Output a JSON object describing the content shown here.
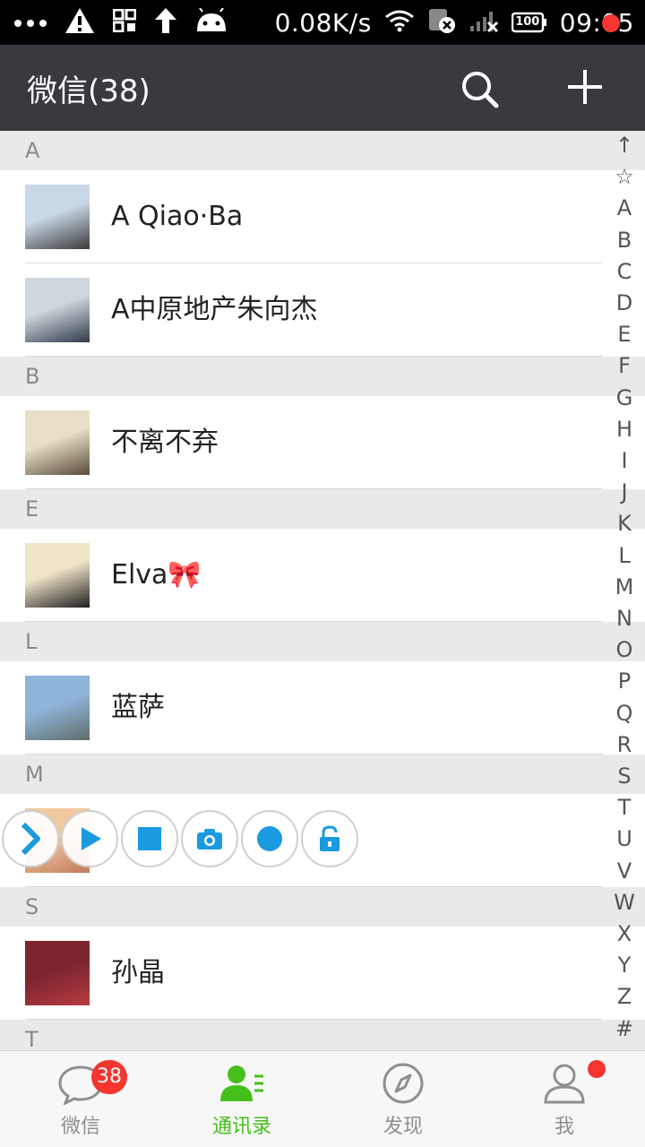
{
  "status_bar": {
    "network_speed": "0.08K/s",
    "battery": "100",
    "time": "09:05",
    "icons": [
      "more-dots-icon",
      "warning-icon",
      "qr-scan-icon",
      "upload-arrow-icon",
      "android-icon",
      "wifi-icon",
      "sim-no-service-icon",
      "signal-no-service-icon",
      "battery-icon"
    ]
  },
  "header": {
    "title": "微信(38)",
    "icons": [
      "search-icon",
      "add-icon"
    ]
  },
  "contacts": {
    "sections": [
      {
        "letter": "A",
        "items": [
          {
            "name": "A Qiao·Ba",
            "avatar_colors": [
              "#c9d8e6",
              "#3b3b3b"
            ]
          },
          {
            "name": "A中原地产朱向杰",
            "avatar_colors": [
              "#cfd6dc",
              "#2f3a4a"
            ]
          }
        ]
      },
      {
        "letter": "B",
        "items": [
          {
            "name": "不离不弃",
            "avatar_colors": [
              "#e8e0c6",
              "#5a4a3a"
            ]
          }
        ]
      },
      {
        "letter": "E",
        "items": [
          {
            "name": "Elva🎀",
            "avatar_colors": [
              "#efe3c8",
              "#1f1f1f"
            ]
          }
        ]
      },
      {
        "letter": "L",
        "items": [
          {
            "name": "蓝萨",
            "avatar_colors": [
              "#8fb4d9",
              "#5f6e6a"
            ]
          }
        ]
      },
      {
        "letter": "M",
        "items": [
          {
            "name": "",
            "avatar_colors": [
              "#f0c9a0",
              "#c07a5a"
            ]
          }
        ]
      },
      {
        "letter": "S",
        "items": [
          {
            "name": "孙晶",
            "avatar_colors": [
              "#7a2530",
              "#b83a40"
            ]
          }
        ]
      },
      {
        "letter": "T",
        "items": []
      }
    ]
  },
  "alphabet_index": [
    "↑",
    "☆",
    "A",
    "B",
    "C",
    "D",
    "E",
    "F",
    "G",
    "H",
    "I",
    "J",
    "K",
    "L",
    "M",
    "N",
    "O",
    "P",
    "Q",
    "R",
    "S",
    "T",
    "U",
    "V",
    "W",
    "X",
    "Y",
    "Z",
    "#"
  ],
  "floating_toolbar": {
    "buttons": [
      "collapse-arrow-icon",
      "play-icon",
      "stop-icon",
      "camera-icon",
      "record-icon",
      "unlock-icon"
    ]
  },
  "bottom_nav": {
    "tabs": [
      {
        "label": "微信",
        "icon": "chat-bubble-icon",
        "badge": "38"
      },
      {
        "label": "通讯录",
        "icon": "contacts-icon",
        "active": true
      },
      {
        "label": "发现",
        "icon": "compass-icon"
      },
      {
        "label": "我",
        "icon": "profile-icon",
        "dot": true
      }
    ]
  },
  "colors": {
    "title_bar": "#393a3f",
    "accent_green": "#45c01a",
    "badge_red": "#f43530",
    "toolbar_blue": "#1a9ae0"
  }
}
